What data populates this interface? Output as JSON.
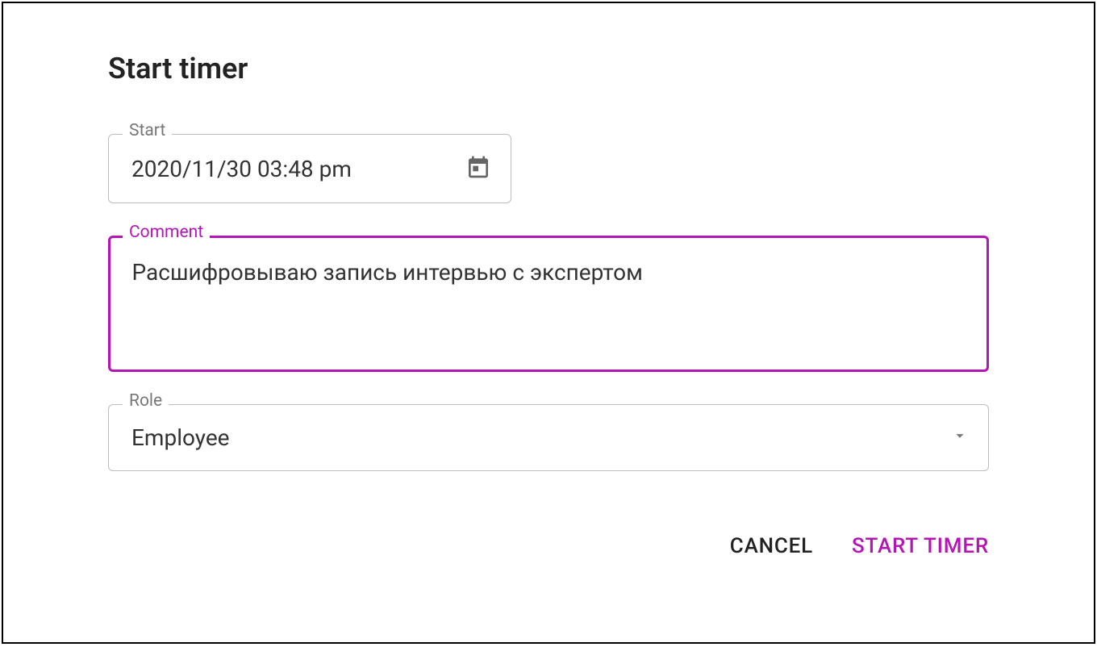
{
  "dialog": {
    "title": "Start timer"
  },
  "fields": {
    "start": {
      "label": "Start",
      "value": "2020/11/30 03:48 pm"
    },
    "comment": {
      "label": "Comment",
      "value": "Расшифровываю запись интервью с экспертом"
    },
    "role": {
      "label": "Role",
      "value": "Employee"
    }
  },
  "actions": {
    "cancel": "CANCEL",
    "submit": "START TIMER"
  },
  "colors": {
    "accent": "#b515b5",
    "border": "#bdbdbd",
    "text": "#333"
  }
}
